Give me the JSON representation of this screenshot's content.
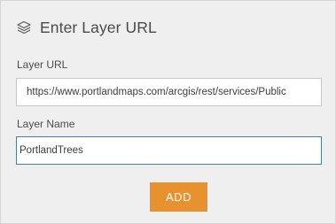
{
  "header": {
    "icon": "layers-icon",
    "title": "Enter Layer URL"
  },
  "form": {
    "layer_url": {
      "label": "Layer URL",
      "value": "https://www.portlandmaps.com/arcgis/rest/services/Public"
    },
    "layer_name": {
      "label": "Layer Name",
      "value": "PortlandTrees"
    },
    "add_label": "ADD"
  },
  "colors": {
    "panel_background": "#efefef",
    "button_accent": "#e8912f",
    "focus_border": "#4d7ea8"
  }
}
